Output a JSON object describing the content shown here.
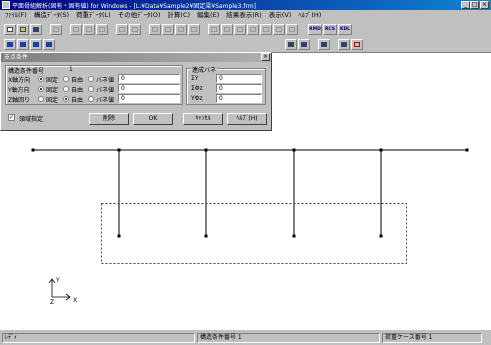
{
  "window": {
    "title": "平面骨組解析(固有・固有値) for Windows - [L:¥Data¥Sample2¥固定梁¥Sample3.frm]",
    "minimize": "_",
    "maximize": "□",
    "close": "×"
  },
  "menu": [
    "ﾌｧｲﾙ(F)",
    "構造ﾃﾞｰﾀ(S)",
    "荷重ﾃﾞｰﾀ(L)",
    "その他ﾃﾞｰﾀ(O)",
    "計算(C)",
    "編集(E)",
    "結果表示(R)",
    "表示(V)",
    "ﾍﾙﾌﾟ(H)"
  ],
  "toolbar": {
    "text_buttons": [
      "RMD",
      "RCS",
      "KDL"
    ]
  },
  "dialog": {
    "title": "支点条件",
    "cond_label": "構造条件番号",
    "cond_value": "1",
    "rows": [
      {
        "label": "X軸方向",
        "fixed": "固定",
        "free": "自由",
        "spring": "バネ値",
        "value": "0",
        "selected": "fixed"
      },
      {
        "label": "Y軸方向",
        "fixed": "固定",
        "free": "自由",
        "spring": "バネ値",
        "value": "0",
        "selected": "fixed"
      },
      {
        "label": "Z軸回り",
        "fixed": "固定",
        "free": "自由",
        "spring": "バネ値",
        "value": "0",
        "selected": "free"
      }
    ],
    "spring_group_title": "連成バネ",
    "spring_rows": [
      {
        "label": "ΣY",
        "value": "0"
      },
      {
        "label": "ΣΦz",
        "value": "0"
      },
      {
        "label": "YΦz",
        "value": "0"
      }
    ],
    "region_label": "領域指定",
    "region_checked": "✓",
    "buttons": {
      "delete": "削除",
      "ok": "OK",
      "cancel": "ｷｬﾝｾﾙ",
      "help": "ﾍﾙﾌﾟ(H)"
    }
  },
  "canvas": {
    "axis_y": "Y",
    "axis_x": "X",
    "axis_z": "Z"
  },
  "status": {
    "left": "ﾚﾃﾞｨ",
    "mid": "構造条件番号 1",
    "right": "荷重ケース番号 1"
  }
}
